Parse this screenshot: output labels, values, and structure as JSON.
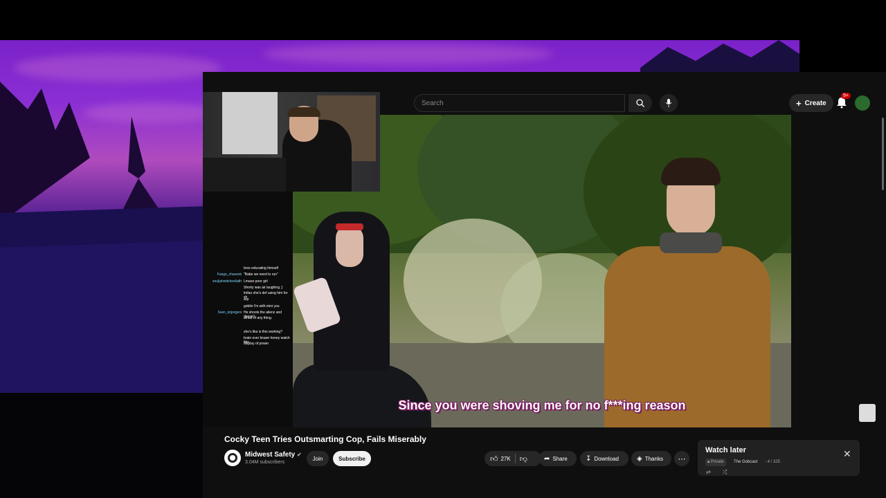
{
  "search": {
    "placeholder": "Search"
  },
  "header": {
    "create_label": "Create",
    "notification_count": "9+"
  },
  "video": {
    "subtitle": "Since you were shoving me for no f***ing reason"
  },
  "chat": [
    {
      "user": "",
      "message": "bros educating himself"
    },
    {
      "user": "Fuego_chavesk",
      "message": "\"Babe we need to run\""
    },
    {
      "user": "souljahwitchesfaith",
      "message": "Lmaoo poor girl"
    },
    {
      "user": "",
      "message": "Shorty was air laughing ;)"
    },
    {
      "user": "",
      "message": "lmfao she's def using him for sh"
    },
    {
      "user": "",
      "message": "arp"
    },
    {
      "user": "",
      "message": "goblin I'm with mini you"
    },
    {
      "user": "Sven_knjorgeni",
      "message": "He shoots the alienz and doesn't"
    },
    {
      "user": "",
      "message": "afraid of any thing."
    },
    {
      "user": "",
      "message": "she's like is this working?"
    },
    {
      "user": "",
      "message": "brain over brawn honey watch this"
    },
    {
      "user": "",
      "message": "display of power"
    }
  ],
  "video_info": {
    "title": "Cocky Teen Tries Outsmarting Cop, Fails Miserably",
    "channel_name": "Midwest Safety",
    "subscribers": "3.04M subscribers",
    "join_label": "Join",
    "subscribe_label": "Subscribe",
    "likes": "27K",
    "share_label": "Share",
    "download_label": "Download",
    "thanks_label": "Thanks"
  },
  "watch_later": {
    "title": "Watch later",
    "privacy": "Private",
    "channel": "The Gobcast",
    "count": "- 4 / 325"
  },
  "colors": {
    "accent_red": "#cc0000",
    "subtitle_outline": "#7a1a66"
  }
}
